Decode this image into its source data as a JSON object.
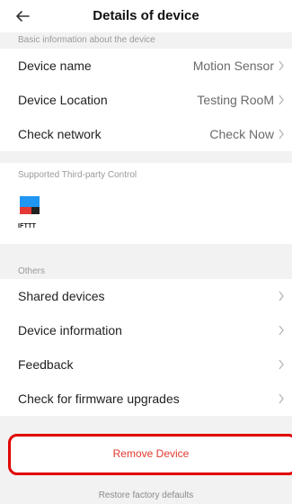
{
  "header": {
    "title": "Details of device",
    "back_icon": "arrow-left-icon"
  },
  "sections": {
    "basic": {
      "label": "Basic information about the device",
      "rows": [
        {
          "label": "Device name",
          "value": "Motion Sensor"
        },
        {
          "label": "Device Location",
          "value": "Testing RooM"
        },
        {
          "label": "Check network",
          "value": "Check Now"
        }
      ]
    },
    "third_party": {
      "label": "Supported Third-party Control",
      "item": {
        "name": "IFTTT",
        "logo_colors": [
          "#2196f3",
          "#e53935",
          "#222222"
        ]
      }
    },
    "others": {
      "label": "Others",
      "rows": [
        {
          "label": "Shared devices"
        },
        {
          "label": "Device information"
        },
        {
          "label": "Feedback"
        },
        {
          "label": "Check for firmware upgrades"
        }
      ]
    }
  },
  "actions": {
    "remove_device": "Remove Device",
    "restore_defaults": "Restore factory defaults"
  },
  "colors": {
    "accent_red": "#e03a2f",
    "highlight": "#e00000"
  }
}
